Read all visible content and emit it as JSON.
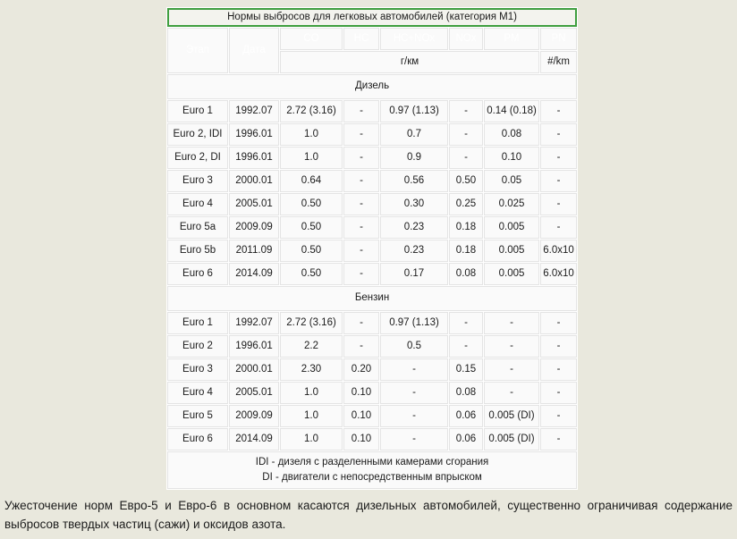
{
  "table": {
    "title": "Нормы выбросов для легковых автомобилей (категория M1)",
    "headers": {
      "stage": "Этап",
      "date": "Дата",
      "co": "CO",
      "hc": "HC",
      "hc_nox": "HC+NOx",
      "nox": "NOx",
      "pm": "PM",
      "pn": "PN"
    },
    "units": {
      "mass": "г/км",
      "number": "#/km"
    },
    "sections": [
      {
        "name": "Дизель",
        "rows": [
          {
            "stage": "Euro 1",
            "date": "1992.07",
            "co": "2.72 (3.16)",
            "hc": "-",
            "hc_nox": "0.97 (1.13)",
            "nox": "-",
            "pm": "0.14 (0.18)",
            "pn": "-"
          },
          {
            "stage": "Euro 2, IDI",
            "date": "1996.01",
            "co": "1.0",
            "hc": "-",
            "hc_nox": "0.7",
            "nox": "-",
            "pm": "0.08",
            "pn": "-"
          },
          {
            "stage": "Euro 2, DI",
            "date": "1996.01",
            "co": "1.0",
            "hc": "-",
            "hc_nox": "0.9",
            "nox": "-",
            "pm": "0.10",
            "pn": "-"
          },
          {
            "stage": "Euro 3",
            "date": "2000.01",
            "co": "0.64",
            "hc": "-",
            "hc_nox": "0.56",
            "nox": "0.50",
            "pm": "0.05",
            "pn": "-"
          },
          {
            "stage": "Euro 4",
            "date": "2005.01",
            "co": "0.50",
            "hc": "-",
            "hc_nox": "0.30",
            "nox": "0.25",
            "pm": "0.025",
            "pn": "-"
          },
          {
            "stage": "Euro 5a",
            "date": "2009.09",
            "co": "0.50",
            "hc": "-",
            "hc_nox": "0.23",
            "nox": "0.18",
            "pm": "0.005",
            "pn": "-"
          },
          {
            "stage": "Euro 5b",
            "date": "2011.09",
            "co": "0.50",
            "hc": "-",
            "hc_nox": "0.23",
            "nox": "0.18",
            "pm": "0.005",
            "pn": "6.0x10"
          },
          {
            "stage": "Euro 6",
            "date": "2014.09",
            "co": "0.50",
            "hc": "-",
            "hc_nox": "0.17",
            "nox": "0.08",
            "pm": "0.005",
            "pn": "6.0x10"
          }
        ]
      },
      {
        "name": "Бензин",
        "rows": [
          {
            "stage": "Euro 1",
            "date": "1992.07",
            "co": "2.72 (3.16)",
            "hc": "-",
            "hc_nox": "0.97 (1.13)",
            "nox": "-",
            "pm": "-",
            "pn": "-"
          },
          {
            "stage": "Euro 2",
            "date": "1996.01",
            "co": "2.2",
            "hc": "-",
            "hc_nox": "0.5",
            "nox": "-",
            "pm": "-",
            "pn": "-"
          },
          {
            "stage": "Euro 3",
            "date": "2000.01",
            "co": "2.30",
            "hc": "0.20",
            "hc_nox": "-",
            "nox": "0.15",
            "pm": "-",
            "pn": "-"
          },
          {
            "stage": "Euro 4",
            "date": "2005.01",
            "co": "1.0",
            "hc": "0.10",
            "hc_nox": "-",
            "nox": "0.08",
            "pm": "-",
            "pn": "-"
          },
          {
            "stage": "Euro 5",
            "date": "2009.09",
            "co": "1.0",
            "hc": "0.10",
            "hc_nox": "-",
            "nox": "0.06",
            "pm": "0.005 (DI)",
            "pn": "-"
          },
          {
            "stage": "Euro 6",
            "date": "2014.09",
            "co": "1.0",
            "hc": "0.10",
            "hc_nox": "-",
            "nox": "0.06",
            "pm": "0.005 (DI)",
            "pn": "-"
          }
        ]
      }
    ],
    "footnote_line1": "IDI - дизеля с разделенными камерами сгорания",
    "footnote_line2": "DI - двигатели с непосредственным впрыском"
  },
  "caption": "Ужесточение норм Евро-5 и Евро-6 в основном касаются дизельных автомобилей, существенно ограничивая содержание выбросов твердых частиц (сажи) и оксидов азота.",
  "colors": {
    "header_green": "#3a9e3a",
    "page_background": "#e9e8dd",
    "cell_background": "#fafafa",
    "text": "#1b1b1b"
  }
}
